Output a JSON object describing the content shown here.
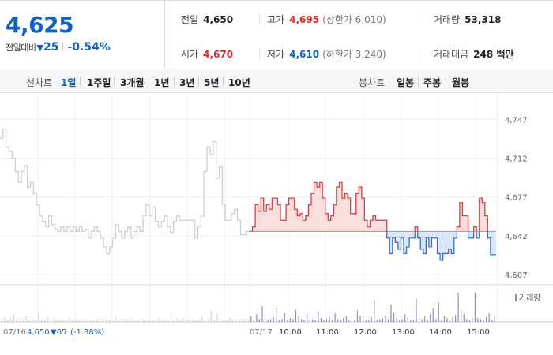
{
  "quote": {
    "price": "4,625",
    "change_label": "전일대비",
    "change_arrow": "▼",
    "change_amount": "25",
    "change_pct": "-0.54%",
    "colors": {
      "down": "#1261c4",
      "up": "#e22828"
    }
  },
  "stats": {
    "prev_close": {
      "label": "전일",
      "value": "4,650"
    },
    "high": {
      "label": "고가",
      "value": "4,695",
      "sub": "(상한가 6,010)"
    },
    "volume": {
      "label": "거래량",
      "value": "53,318"
    },
    "open": {
      "label": "시가",
      "value": "4,670"
    },
    "low": {
      "label": "저가",
      "value": "4,610",
      "sub": "(하한가 3,240)"
    },
    "amount": {
      "label": "거래대금",
      "value": "248 백만"
    }
  },
  "toolbar": {
    "line_chart_label": "선차트",
    "periods": [
      "1일",
      "1주일",
      "3개월",
      "1년",
      "3년",
      "5년",
      "10년"
    ],
    "active_period": "1일",
    "candle_chart_label": "봉차트",
    "candles": [
      "일봉",
      "주봉",
      "월봉"
    ]
  },
  "chart_data": {
    "type": "line",
    "prev_close": 4646,
    "y_ticks": [
      "4,747",
      "4,712",
      "4,677",
      "4,642",
      "4,607"
    ],
    "y_tick_values": [
      4747,
      4712,
      4677,
      4642,
      4607
    ],
    "ylim": [
      4600,
      4755
    ],
    "x_ticks": [
      "07/17",
      "10:00",
      "11:00",
      "12:00",
      "13:00",
      "14:00",
      "15:00"
    ],
    "volume_legend": "거래량",
    "prev_day_footer": {
      "date": "07/16",
      "close": "4,650",
      "change": "▼65",
      "pct": "(-1.38%)"
    },
    "colors": {
      "up_line": "#e83a3a",
      "up_fill": "#fbdede",
      "down_line": "#3070d6",
      "down_fill": "#dbe7f8",
      "prev_line": "#cfcfcf",
      "volume": "#9a88c9"
    },
    "prev_day_series": [
      4730,
      4738,
      4722,
      4718,
      4712,
      4700,
      4690,
      4700,
      4705,
      4686,
      4690,
      4680,
      4670,
      4660,
      4655,
      4650,
      4660,
      4652,
      4648,
      4646,
      4650,
      4646,
      4650,
      4646,
      4650,
      4646,
      4650,
      4646,
      4648,
      4640,
      4646,
      4650,
      4646,
      4640,
      4632,
      4626,
      4632,
      4640,
      4652,
      4646,
      4640,
      4646,
      4650,
      4640,
      4646,
      4650,
      4646,
      4660,
      4670,
      4660,
      4668,
      4655,
      4650,
      4655,
      4660,
      4650,
      4645,
      4655,
      4660,
      4656,
      4656,
      4656,
      4656,
      4656,
      4640,
      4650,
      4660,
      4700,
      4722,
      4715,
      4727,
      4694,
      4704,
      4670,
      4656,
      4656,
      4662,
      4666,
      4656,
      4643,
      4643,
      4646
    ],
    "today_series": [
      4646,
      4650,
      4670,
      4664,
      4676,
      4664,
      4670,
      4666,
      4676,
      4676,
      4670,
      4656,
      4656,
      4670,
      4676,
      4676,
      4666,
      4660,
      4662,
      4656,
      4660,
      4670,
      4680,
      4690,
      4686,
      4690,
      4676,
      4662,
      4656,
      4660,
      4670,
      4686,
      4690,
      4676,
      4680,
      4676,
      4662,
      4662,
      4680,
      4686,
      4676,
      4656,
      4650,
      4656,
      4660,
      4656,
      4656,
      4656,
      4656,
      4640,
      4626,
      4640,
      4636,
      4630,
      4640,
      4626,
      4632,
      4640,
      4640,
      4650,
      4640,
      4630,
      4626,
      4640,
      4632,
      4640,
      4640,
      4626,
      4620,
      4626,
      4626,
      4630,
      4626,
      4640,
      4650,
      4672,
      4660,
      4660,
      4640,
      4640,
      4650,
      4640,
      4676,
      4672,
      4660,
      4640,
      4625,
      4625
    ],
    "today_volume": [
      6,
      2,
      8,
      3,
      16,
      4,
      2,
      3,
      5,
      14,
      2,
      3,
      9,
      2,
      4,
      3,
      12,
      6,
      3,
      2,
      8,
      2,
      3,
      2,
      11,
      4,
      2,
      3,
      5,
      2,
      9,
      3,
      2,
      4,
      6,
      2,
      3,
      2,
      12,
      6,
      3,
      2,
      2,
      5,
      22,
      2,
      3,
      4,
      6,
      3,
      18,
      9,
      4,
      2,
      3,
      8,
      5,
      2,
      2,
      24,
      4,
      3,
      6,
      2,
      8,
      14,
      3,
      20,
      2,
      6,
      4,
      2,
      5,
      7,
      30,
      12,
      8,
      3,
      2,
      4,
      30,
      4,
      3,
      2,
      5,
      9,
      2,
      6
    ],
    "prev_volume": [
      3,
      5,
      2,
      4,
      8,
      2,
      3,
      2,
      6,
      2,
      4,
      2,
      9,
      3,
      2,
      5,
      2,
      3,
      2,
      2,
      3,
      2,
      4,
      2,
      3,
      2,
      2,
      2,
      3,
      2,
      2,
      3,
      2,
      2,
      3,
      2,
      2,
      6,
      2,
      3,
      2,
      2,
      3,
      2,
      2,
      2,
      3,
      2,
      2,
      2,
      2,
      3,
      2,
      2,
      2,
      8,
      2,
      3,
      2,
      4,
      2,
      2,
      3,
      2,
      2,
      5,
      2,
      3,
      12,
      2,
      9,
      3,
      2,
      2,
      4,
      2,
      3,
      2,
      2,
      3,
      2
    ]
  }
}
